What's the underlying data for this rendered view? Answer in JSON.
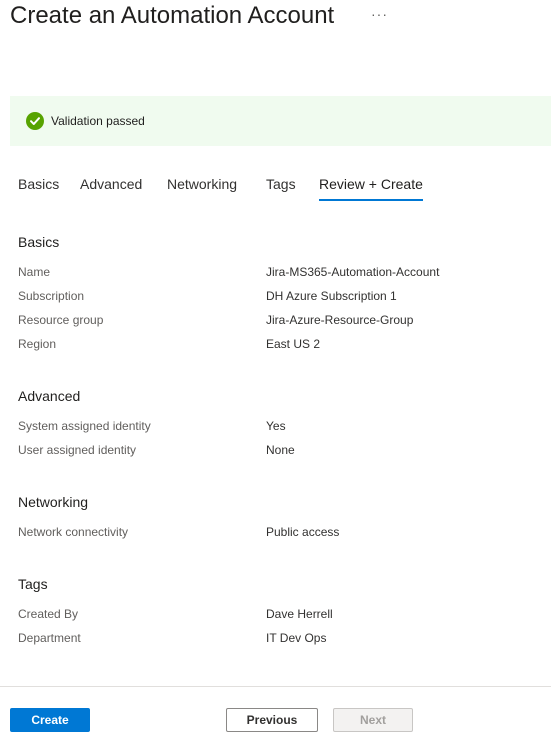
{
  "header": {
    "title": "Create an Automation Account",
    "more_label": "···"
  },
  "banner": {
    "status": "success",
    "message": "Validation passed"
  },
  "tabs": [
    {
      "label": "Basics",
      "active": false
    },
    {
      "label": "Advanced",
      "active": false
    },
    {
      "label": "Networking",
      "active": false
    },
    {
      "label": "Tags",
      "active": false
    },
    {
      "label": "Review + Create",
      "active": true
    }
  ],
  "sections": {
    "basics": {
      "title": "Basics",
      "rows": [
        {
          "label": "Name",
          "value": "Jira-MS365-Automation-Account"
        },
        {
          "label": "Subscription",
          "value": "DH Azure Subscription 1"
        },
        {
          "label": "Resource group",
          "value": "Jira-Azure-Resource-Group"
        },
        {
          "label": "Region",
          "value": "East US 2"
        }
      ]
    },
    "advanced": {
      "title": "Advanced",
      "rows": [
        {
          "label": "System assigned identity",
          "value": "Yes"
        },
        {
          "label": "User assigned identity",
          "value": "None"
        }
      ]
    },
    "networking": {
      "title": "Networking",
      "rows": [
        {
          "label": "Network connectivity",
          "value": "Public access"
        }
      ]
    },
    "tags": {
      "title": "Tags",
      "rows": [
        {
          "label": "Created By",
          "value": "Dave Herrell"
        },
        {
          "label": "Department",
          "value": "IT Dev Ops"
        }
      ]
    }
  },
  "footer": {
    "create_label": "Create",
    "previous_label": "Previous",
    "next_label": "Next"
  },
  "colors": {
    "accent": "#0078d4",
    "success": "#57a300",
    "banner_bg": "#f0fbef"
  }
}
